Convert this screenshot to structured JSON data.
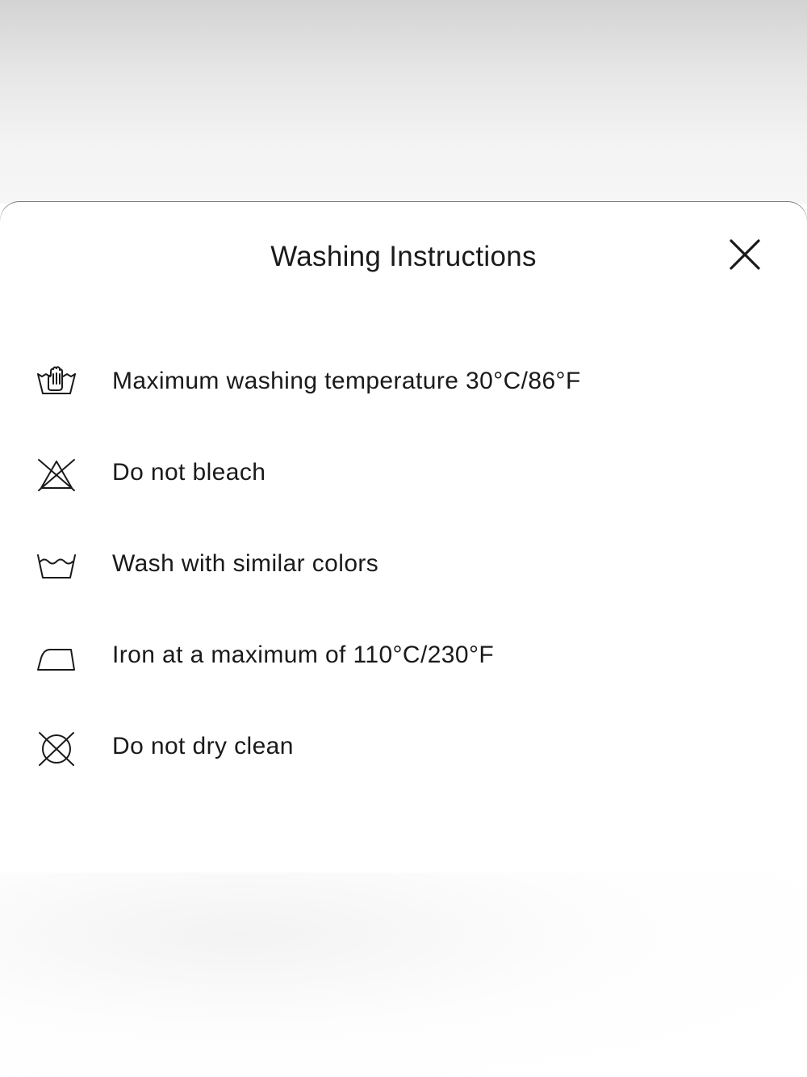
{
  "modal": {
    "title": "Washing Instructions",
    "close_icon": "close-icon"
  },
  "care_items": [
    {
      "icon": "hand-wash-icon",
      "label": "Maximum washing temperature 30°C/86°F"
    },
    {
      "icon": "do-not-bleach-icon",
      "label": "Do not bleach"
    },
    {
      "icon": "wash-tub-icon",
      "label": "Wash with similar colors"
    },
    {
      "icon": "iron-icon",
      "label": "Iron at a maximum of 110°C/230°F"
    },
    {
      "icon": "do-not-dry-clean-icon",
      "label": "Do not dry clean"
    }
  ],
  "colors": {
    "text": "#1a1a1a",
    "sheet_background": "#ffffff",
    "backdrop": "#e6e6e6"
  }
}
